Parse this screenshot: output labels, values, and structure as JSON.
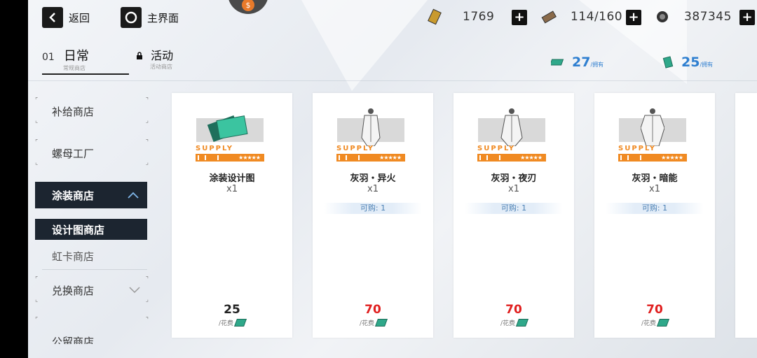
{
  "topbar": {
    "back_label": "返回",
    "home_label": "主界面",
    "resources": [
      {
        "name": "stamina",
        "icon": "ticket-icon",
        "value": "1769"
      },
      {
        "name": "energy",
        "icon": "battery-icon",
        "value": "114/160"
      },
      {
        "name": "coins",
        "icon": "coin-icon",
        "value": "387345"
      }
    ]
  },
  "tabs": [
    {
      "num": "01",
      "label": "日常",
      "sub": "常规商店",
      "locked": false,
      "active": true
    },
    {
      "num": "",
      "label": "活动",
      "sub": "活动商店",
      "locked": true,
      "active": false
    }
  ],
  "currencies": [
    {
      "icon": "green-ticket-icon",
      "value": "27",
      "suffix": "/拥有"
    },
    {
      "icon": "green-card-icon",
      "value": "25",
      "suffix": "/拥有"
    }
  ],
  "sidebar": {
    "items": [
      {
        "label": "补给商店"
      },
      {
        "label": "螺母工厂"
      },
      {
        "label": "涂装商店"
      },
      {
        "label": "设计图商店"
      },
      {
        "label": "虹卡商店"
      },
      {
        "label": "兑换商店"
      },
      {
        "label": "公留商店"
      }
    ]
  },
  "cards": [
    {
      "supply": "SUPPLY",
      "stars": "★★★★★",
      "name": "涂装设计图",
      "qty": "x1",
      "limit": "",
      "price": "25",
      "price_color": "#222222",
      "cost_label": "/花费"
    },
    {
      "supply": "SUPPLY",
      "stars": "★★★★★",
      "name": "灰羽・异火",
      "qty": "x1",
      "limit": "可购: 1",
      "price": "70",
      "price_color": "#e02020",
      "cost_label": "/花费"
    },
    {
      "supply": "SUPPLY",
      "stars": "★★★★★",
      "name": "灰羽・夜刃",
      "qty": "x1",
      "limit": "可购: 1",
      "price": "70",
      "price_color": "#e02020",
      "cost_label": "/花费"
    },
    {
      "supply": "SUPPLY",
      "stars": "★★★★★",
      "name": "灰羽・暗能",
      "qty": "x1",
      "limit": "可购: 1",
      "price": "70",
      "price_color": "#e02020",
      "cost_label": "/花费"
    }
  ],
  "colors": {
    "accent_orange": "#f08a22",
    "price_red": "#e02020",
    "currency_blue": "#2f7fd0",
    "active_dark": "#1c2530"
  }
}
